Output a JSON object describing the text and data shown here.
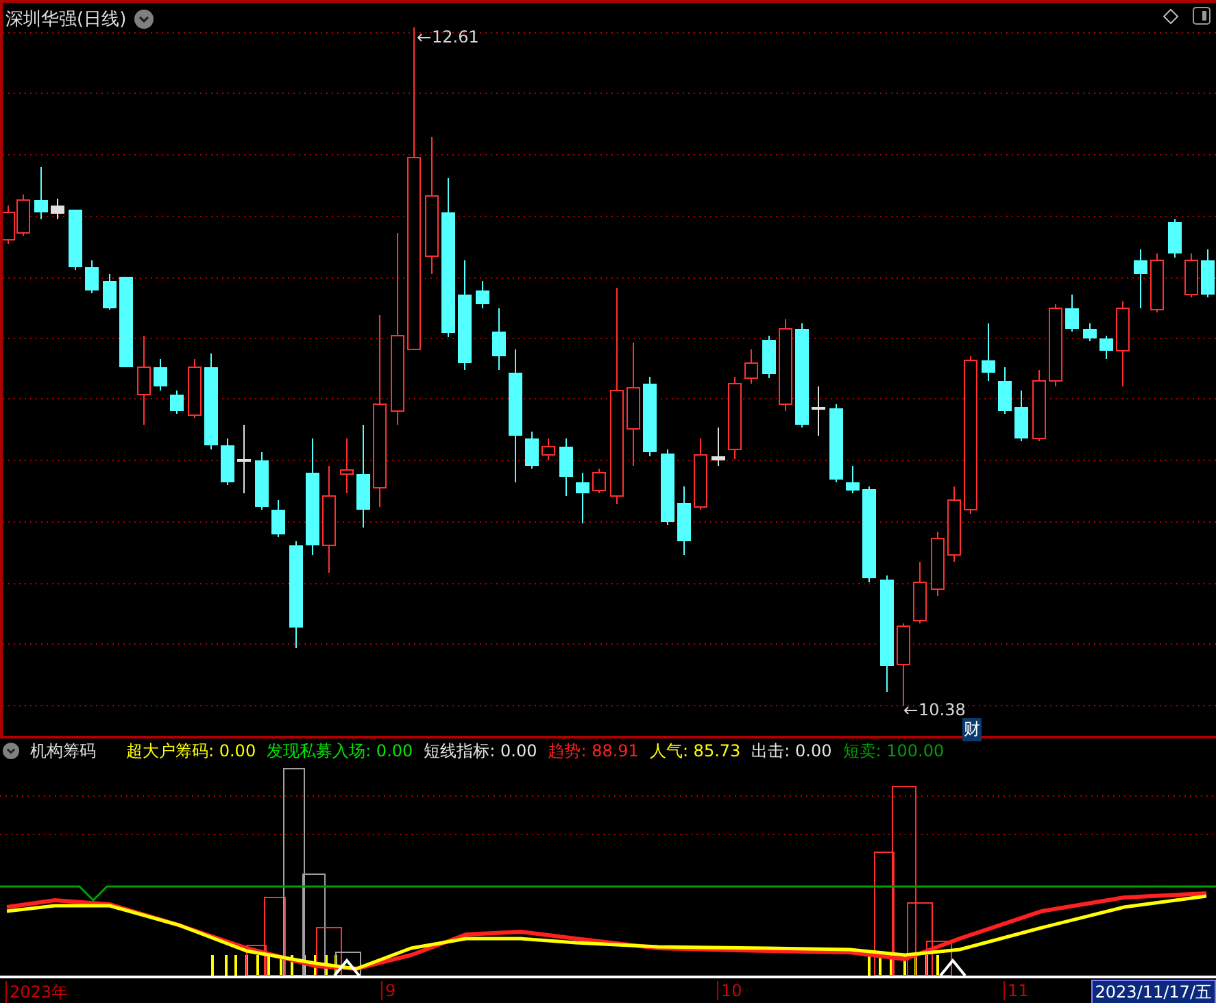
{
  "chart": {
    "title": "深圳华强(日线)",
    "high_label": "12.61",
    "low_label": "10.38",
    "badge": "财"
  },
  "indicator": {
    "name": "机构筹码",
    "readings": [
      {
        "text": "超大户筹码: 0.00",
        "color": "#ffff00"
      },
      {
        "text": "发现私募入场: 0.00",
        "color": "#00e600"
      },
      {
        "text": "短线指标: 0.00",
        "color": "#e6e6e6"
      },
      {
        "text": "趋势: 88.91",
        "color": "#ff2020"
      },
      {
        "text": "人气: 85.73",
        "color": "#ffff00"
      },
      {
        "text": "出击: 0.00",
        "color": "#e6e6e6"
      },
      {
        "text": "短卖: 100.00",
        "color": "#00a000"
      }
    ]
  },
  "axis": {
    "labels": [
      "2023年",
      "9",
      "10",
      "11"
    ],
    "current_date": "2023/11/17/五"
  }
}
